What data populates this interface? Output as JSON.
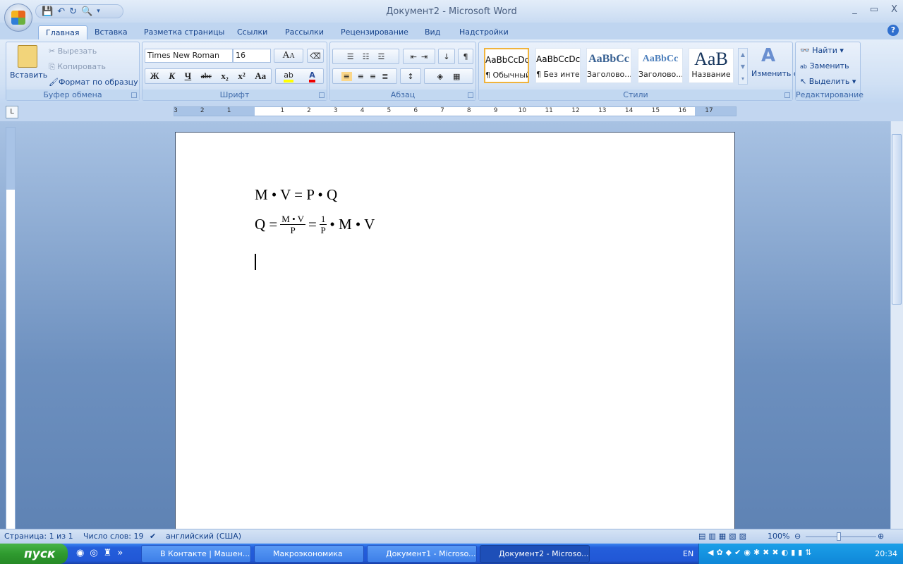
{
  "window": {
    "title": "Документ2 - Microsoft Word",
    "minimize": "_",
    "maximize": "▭",
    "close": "X",
    "help": "?"
  },
  "tabs": [
    "Главная",
    "Вставка",
    "Разметка страницы",
    "Ссылки",
    "Рассылки",
    "Рецензирование",
    "Вид",
    "Надстройки"
  ],
  "clipboard": {
    "paste": "Вставить",
    "cut": "Вырезать",
    "copy": "Копировать",
    "format_painter": "Формат по образцу",
    "label": "Буфер обмена"
  },
  "font": {
    "name": "Times New Roman",
    "size": "16",
    "bold": "Ж",
    "italic": "К",
    "underline": "Ч",
    "strike": "abc",
    "subscript": "x₂",
    "superscript": "x²",
    "case": "Aa",
    "grow": "A",
    "shrink": "A",
    "label": "Шрифт"
  },
  "paragraph": {
    "label": "Абзац",
    "pilcrow": "¶"
  },
  "styles": {
    "items": [
      {
        "sample": "AaBbCcDc",
        "name": "¶ Обычный"
      },
      {
        "sample": "AaBbCcDc",
        "name": "¶ Без инте..."
      },
      {
        "sample": "AaBbCc",
        "name": "Заголово..."
      },
      {
        "sample": "AaBbCc",
        "name": "Заголово..."
      },
      {
        "sample": "AaB",
        "name": "Название"
      }
    ],
    "change": "Изменить стили",
    "label": "Стили"
  },
  "editing": {
    "find": "Найти",
    "replace": "Заменить",
    "select": "Выделить",
    "label": "Редактирование"
  },
  "ruler": {
    "ticks": [
      "3",
      "2",
      "1",
      "",
      "1",
      "2",
      "3",
      "4",
      "5",
      "6",
      "7",
      "8",
      "9",
      "10",
      "11",
      "12",
      "13",
      "14",
      "15",
      "16",
      "17"
    ]
  },
  "document": {
    "line1": "M • V = P • Q",
    "line2_left": "Q =",
    "frac1_num": "M • V",
    "frac1_den": "P",
    "eq": "=",
    "frac2_num": "1",
    "frac2_den": "P",
    "line2_right": "• M • V"
  },
  "status": {
    "page": "Страница: 1 из 1",
    "words": "Число слов: 19",
    "language": "английский (США)",
    "zoom": "100%"
  },
  "taskbar": {
    "start": "пуск",
    "tasks": [
      "В Контакте | Машен...",
      "Макроэкономика",
      "Документ1 - Microso...",
      "Документ2 - Microso..."
    ],
    "lang": "EN",
    "clock": "20:34"
  }
}
